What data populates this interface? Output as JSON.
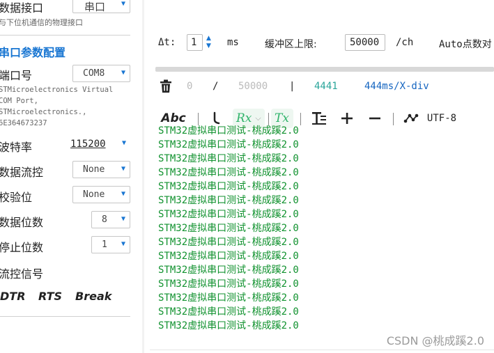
{
  "left_panel": {
    "interface_label": "数据接口",
    "interface_value": "串口",
    "interface_hint": "与下位机通信的物理接口",
    "section_title": "串口参数配置",
    "port_label": "端口号",
    "port_value": "COM8",
    "port_desc": [
      "STMicroelectronics Virtual",
      "COM Port,",
      "STMicroelectronics.,",
      "6E364673237"
    ],
    "baud_label": "波特率",
    "baud_value": "115200",
    "flow_label": "数据流控",
    "flow_value": "None",
    "parity_label": "校验位",
    "parity_value": "None",
    "databits_label": "数据位数",
    "databits_value": "8",
    "stopbits_label": "停止位数",
    "stopbits_value": "1",
    "flowsig_label": "流控信号",
    "signals": [
      "DTR",
      "RTS",
      "Break"
    ]
  },
  "params": {
    "dt_label": "Δt:",
    "dt_value": "1",
    "dt_unit": "ms",
    "buffer_label": "缓冲区上限:",
    "buffer_value": "50000",
    "buffer_unit": "/ch",
    "auto_label": "Auto点数对"
  },
  "status": {
    "current": "0",
    "slash": "/",
    "max": "50000",
    "bar": "|",
    "count": "4441",
    "xdiv": "444ms/X-div",
    "count_color": "#2aa59a",
    "xdiv_color": "#1565c0"
  },
  "toolbar": {
    "abc_label": "Abc",
    "rx_label": "Rx",
    "tx_label": "Tx",
    "encoding_label": "UTF-8"
  },
  "log_lines": [
    "STM32虚拟串口测试-桃成蹊2.0",
    "STM32虚拟串口测试-桃成蹊2.0",
    "STM32虚拟串口测试-桃成蹊2.0",
    "STM32虚拟串口测试-桃成蹊2.0",
    "STM32虚拟串口测试-桃成蹊2.0",
    "STM32虚拟串口测试-桃成蹊2.0",
    "STM32虚拟串口测试-桃成蹊2.0",
    "STM32虚拟串口测试-桃成蹊2.0",
    "STM32虚拟串口测试-桃成蹊2.0",
    "STM32虚拟串口测试-桃成蹊2.0",
    "STM32虚拟串口测试-桃成蹊2.0",
    "STM32虚拟串口测试-桃成蹊2.0",
    "STM32虚拟串口测试-桃成蹊2.0",
    "STM32虚拟串口测试-桃成蹊2.0",
    "STM32虚拟串口测试-桃成蹊2.0"
  ],
  "watermark": "CSDN @桃成蹊2.0",
  "colors": {
    "accent": "#1976d2",
    "log_text": "#11922f",
    "toggle_green": "#2fb36a"
  }
}
